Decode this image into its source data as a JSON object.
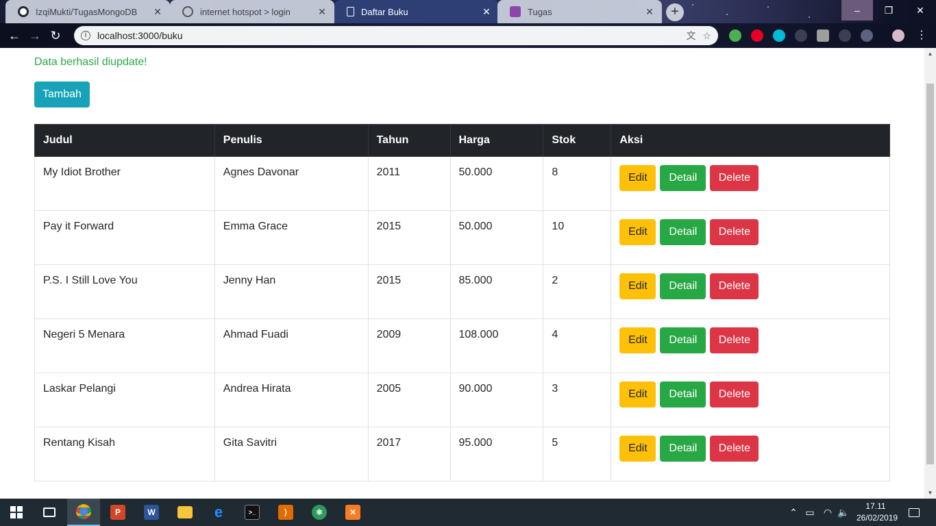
{
  "browser": {
    "tabs": [
      {
        "title": "IzqiMukti/TugasMongoDB",
        "icon": "github-icon",
        "active": false
      },
      {
        "title": "internet hotspot > login",
        "icon": "hotspot-icon",
        "active": false
      },
      {
        "title": "Daftar Buku",
        "icon": "page-icon",
        "active": true
      },
      {
        "title": "Tugas",
        "icon": "classroom-icon",
        "active": false
      }
    ],
    "url": "localhost:3000/buku",
    "close_glyph": "✕",
    "new_tab_glyph": "+"
  },
  "page": {
    "alert": "Data berhasil diupdate!",
    "add_button": "Tambah",
    "table": {
      "headers": [
        "Judul",
        "Penulis",
        "Tahun",
        "Harga",
        "Stok",
        "Aksi"
      ],
      "rows": [
        {
          "judul": "My Idiot Brother",
          "penulis": "Agnes Davonar",
          "tahun": "2011",
          "harga": "50.000",
          "stok": "8"
        },
        {
          "judul": "Pay it Forward",
          "penulis": "Emma Grace",
          "tahun": "2015",
          "harga": "50.000",
          "stok": "10"
        },
        {
          "judul": "P.S. I Still Love You",
          "penulis": "Jenny Han",
          "tahun": "2015",
          "harga": "85.000",
          "stok": "2"
        },
        {
          "judul": "Negeri 5 Menara",
          "penulis": "Ahmad Fuadi",
          "tahun": "2009",
          "harga": "108.000",
          "stok": "4"
        },
        {
          "judul": "Laskar Pelangi",
          "penulis": "Andrea Hirata",
          "tahun": "2005",
          "harga": "90.000",
          "stok": "3"
        },
        {
          "judul": "Rentang Kisah",
          "penulis": "Gita Savitri",
          "tahun": "2017",
          "harga": "95.000",
          "stok": "5"
        }
      ],
      "actions": {
        "edit": "Edit",
        "detail": "Detail",
        "delete": "Delete"
      }
    }
  },
  "taskbar": {
    "time": "17.11",
    "date": "26/02/2019",
    "apps": [
      "chrome-icon",
      "powerpoint-icon",
      "word-icon",
      "file-explorer-icon",
      "edge-icon",
      "terminal-icon",
      "vscode-icon",
      "atom-icon",
      "xampp-icon"
    ]
  },
  "colors": {
    "info": "#17a2b8",
    "success": "#28a745",
    "warning": "#ffc107",
    "danger": "#dc3545",
    "dark": "#212529"
  }
}
